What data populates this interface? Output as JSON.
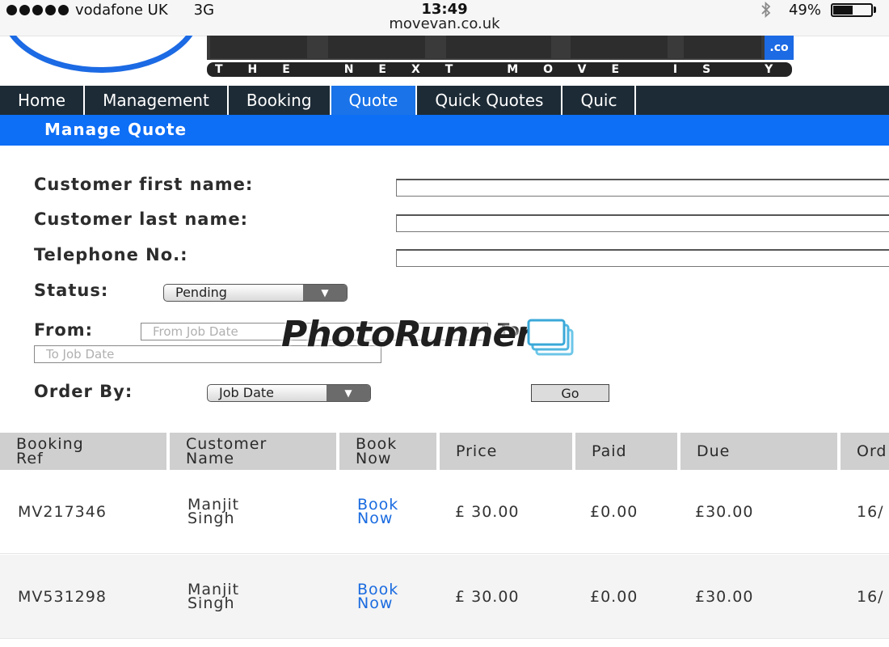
{
  "status_bar": {
    "carrier": "vodafone UK",
    "network": "3G",
    "time": "13:49",
    "url": "movevan.co.uk",
    "battery_text": "49%",
    "battery_level": 0.49
  },
  "logo": {
    "tagline": "THE NEXT MOVE IS YOURS",
    "suffix": ".co"
  },
  "nav": {
    "items": [
      {
        "label": "Home",
        "active": false
      },
      {
        "label": "Management",
        "active": false
      },
      {
        "label": "Booking",
        "active": false
      },
      {
        "label": "Quote",
        "active": true
      },
      {
        "label": "Quick Quotes",
        "active": false
      },
      {
        "label": "Quic",
        "active": false
      }
    ]
  },
  "section": {
    "title": "Manage Quote"
  },
  "form": {
    "first_name_label": "Customer first name:",
    "last_name_label": "Customer last name:",
    "telephone_label": "Telephone No.:",
    "status_label": "Status:",
    "status_value": "Pending",
    "from_label": "From:",
    "from_placeholder": "From Job Date",
    "to_label": "To:",
    "to_placeholder": "To Job Date",
    "order_by_label": "Order By:",
    "order_by_value": "Job Date",
    "go_label": "Go"
  },
  "watermark": {
    "text": "PhotoRunner"
  },
  "table": {
    "columns": [
      {
        "line1": "Booking",
        "line2": "Ref"
      },
      {
        "line1": "Customer",
        "line2": "Name"
      },
      {
        "line1": "Book",
        "line2": "Now"
      },
      {
        "line1": "Price",
        "line2": ""
      },
      {
        "line1": "Paid",
        "line2": ""
      },
      {
        "line1": "Due",
        "line2": ""
      },
      {
        "line1": "Ord",
        "line2": ""
      }
    ],
    "rows": [
      {
        "ref": "MV217346",
        "name_line1": "Manjit",
        "name_line2": "Singh",
        "book_line1": "Book",
        "book_line2": "Now",
        "price": "£ 30.00",
        "paid": "£0.00",
        "due": "£30.00",
        "order": "16/"
      },
      {
        "ref": "MV531298",
        "name_line1": "Manjit",
        "name_line2": "Singh",
        "book_line1": "Book",
        "book_line2": "Now",
        "price": "£ 30.00",
        "paid": "£0.00",
        "due": "£30.00",
        "order": "16/"
      }
    ]
  }
}
